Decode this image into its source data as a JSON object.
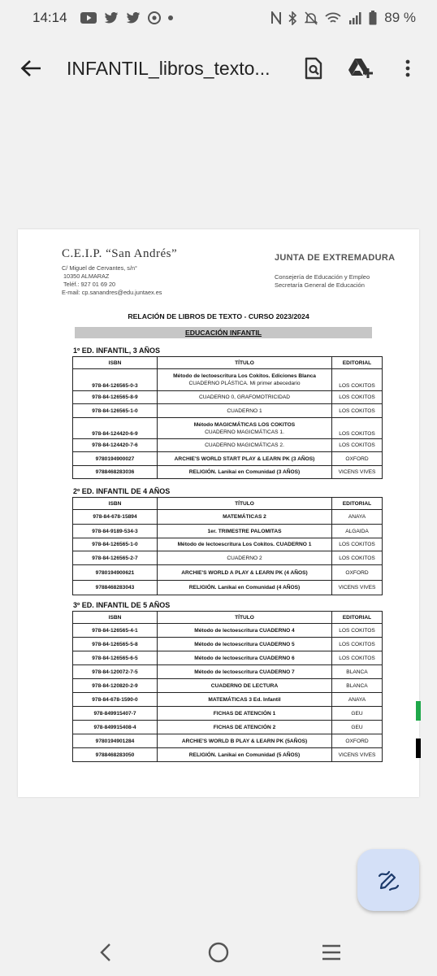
{
  "status": {
    "time": "14:14",
    "battery": "89 %",
    "notif_icons": [
      "youtube-icon",
      "twitter-icon",
      "twitter-icon",
      "chrome-icon",
      "dot-icon"
    ],
    "system_icons": [
      "nfc-icon",
      "bluetooth-icon",
      "mute-icon",
      "wifi-icon",
      "signal-icon",
      "battery-icon"
    ]
  },
  "appbar": {
    "title": "INFANTIL_libros_texto..."
  },
  "doc": {
    "school_name": "C.E.I.P. “San Andrés”",
    "school_address": "C/ Miguel de Cervantes, s/n°",
    "school_city": "10350 ALMARAZ",
    "school_phone": "Teléf.: 927 01 69 20",
    "school_email": "E-mail: cp.sanandres@edu.juntaex.es",
    "junta": "JUNTA DE EXTREMADURA",
    "consejeria_1": "Consejería de Educación y Empleo",
    "consejeria_2": "Secretaría General de Educación",
    "relation_title": "RELACIÓN DE LIBROS DE TEXTO - CURSO 2023/2024",
    "edu_title": "EDUCACIÓN INFANTIL",
    "headers": {
      "isbn": "ISBN",
      "titulo": "TÍTULO",
      "editorial": "EDITORIAL"
    },
    "sections": [
      {
        "title": "1º ED. INFANTIL, 3 AÑOS",
        "rows": [
          {
            "isbn": "978-84-126565-0-3",
            "t1": "Método de lectoescritura Los Cokitos. Ediciones Blanca",
            "t2": "CUADERNO PLÁSTICA. Mi primer abecedario",
            "ed": "LOS COKITOS"
          },
          {
            "isbn": "978-84-126565-8-9",
            "t1": "CUADERNO 0, GRAFOMOTRICIDAD",
            "t2": "",
            "ed": "LOS COKITOS"
          },
          {
            "isbn": "978-84-126565-1-0",
            "t1": "CUADERNO 1",
            "t2": "",
            "ed": "LOS COKITOS"
          },
          {
            "isbn": "978-84-124420-6-9",
            "t1": "Método MAGICMÁTICAS LOS COKITOS",
            "t2": "CUADERNO MAGICMÁTICAS 1.",
            "ed": "LOS COKITOS"
          },
          {
            "isbn": "978-84-124420-7-6",
            "t1": "CUADERNO MAGICMÁTICAS 2.",
            "t2": "",
            "ed": "LOS COKITOS"
          },
          {
            "isbn": "9780194900027",
            "t1": "ARCHIE'S WORLD START PLAY & LEARN PK (3 AÑOS)",
            "t2": "",
            "ed": "OXFORD"
          },
          {
            "isbn": "9788468283036",
            "t1": "RELIGIÓN. Lanikai en Comunidad (3 AÑOS)",
            "t2": "",
            "ed": "VICENS VIVES"
          }
        ]
      },
      {
        "title": "2º ED. INFANTIL DE 4 AÑOS",
        "rows": [
          {
            "isbn": "978-84-678-15894",
            "t1": "MATEMÁTICAS 2",
            "t2": "",
            "ed": "ANAYA"
          },
          {
            "isbn": "978-84-9189-534-3",
            "t1": "1er. TRIMESTRE PALOMITAS",
            "t2": "",
            "ed": "ALGAIDA"
          },
          {
            "isbn": "978-84-126565-1-0",
            "t1": "Método de lectoescritura Los Cokitos. CUADERNO 1",
            "t2": "",
            "ed": "LOS COKITOS"
          },
          {
            "isbn": "978-84-126565-2-7",
            "t1": "CUADERNO 2",
            "t2": "",
            "ed": "LOS COKITOS"
          },
          {
            "isbn": "9780194900621",
            "t1": "ARCHIE'S WORLD A PLAY & LEARN PK (4 AÑOS)",
            "t2": "",
            "ed": "OXFORD"
          },
          {
            "isbn": "9788468283043",
            "t1": "RELIGIÓN. Lanikai en Comunidad (4 AÑOS)",
            "t2": "",
            "ed": "VICENS VIVES"
          }
        ]
      },
      {
        "title": "3º ED. INFANTIL DE 5 AÑOS",
        "rows": [
          {
            "isbn": "978-84-126565-4-1",
            "t1": "Método de lectoescritura CUADERNO 4",
            "t2": "",
            "ed": "LOS COKITOS"
          },
          {
            "isbn": "978-84-126565-5-8",
            "t1": "Método de lectoescritura CUADERNO 5",
            "t2": "",
            "ed": "LOS COKITOS"
          },
          {
            "isbn": "978-84-126565-6-5",
            "t1": "Método de lectoescritura CUADERNO 6",
            "t2": "",
            "ed": "LOS COKITOS"
          },
          {
            "isbn": "978-84-120072-7-5",
            "t1": "Método de lectoescritura CUADERNO 7",
            "t2": "",
            "ed": "BLANCA"
          },
          {
            "isbn": "978-84-120820-2-9",
            "t1": "CUADERNO DE LECTURA",
            "t2": "",
            "ed": "BLANCA"
          },
          {
            "isbn": "978-84-678-1590-0",
            "t1": "MATEMÁTICAS 3 Ed. Infantil",
            "t2": "",
            "ed": "ANAYA"
          },
          {
            "isbn": "978-849915407-7",
            "t1": "FICHAS DE ATENCIÓN 1",
            "t2": "",
            "ed": "GEU"
          },
          {
            "isbn": "978-849915408-4",
            "t1": "FICHAS DE ATENCIÓN 2",
            "t2": "",
            "ed": "GEU"
          },
          {
            "isbn": "9780194901284",
            "t1": "ARCHIE'S WORLD B PLAY & LEARN PK (5AÑOS)",
            "t2": "",
            "ed": "OXFORD"
          },
          {
            "isbn": "9788468283050",
            "t1": "RELIGIÓN. Lanikai en Comunidad (5 AÑOS)",
            "t2": "",
            "ed": "VICENS VIVES"
          }
        ]
      }
    ]
  },
  "colors": {
    "background": "#f1f1f1",
    "fab": "#d4e0f7",
    "accent_green": "#1fa84a"
  }
}
